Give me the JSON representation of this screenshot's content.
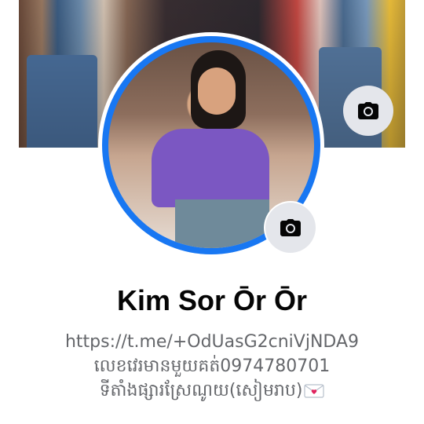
{
  "profile": {
    "name": "Kim Sor Ōr Ōr",
    "bio_lines": [
      "https://t.me/+OdUasG2cniVjNDA9",
      "លេខវេរមានមួយគត់0974780701",
      "ទីតាំងផ្សារស្រែណូយ(សៀមរាប)"
    ],
    "bio_emoji": "love-letter-icon"
  },
  "cover_photo": {
    "camera_icon": "camera-icon"
  },
  "avatar": {
    "camera_icon": "camera-icon",
    "ring_color": "#1877f2"
  },
  "colors": {
    "button_bg": "#e4e6eb",
    "name_text": "#050505",
    "bio_text": "#65676b"
  }
}
